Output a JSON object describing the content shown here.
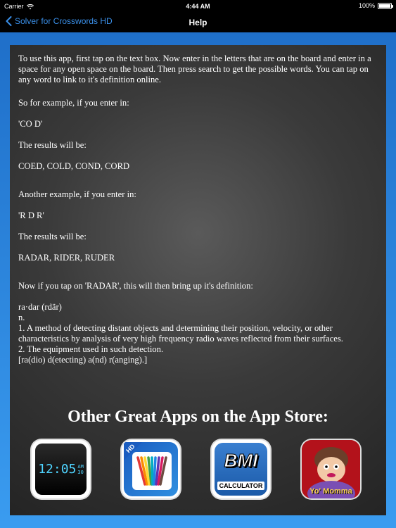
{
  "status_bar": {
    "carrier": "Carrier",
    "time": "4:44 AM",
    "battery": "100%",
    "battery_level": 1.0
  },
  "nav": {
    "back_label": "Solver for Crosswords HD",
    "title": "Help"
  },
  "help": {
    "intro": "To use this app, first tap on the text box. Now enter in the letters that are on the board and enter in a space for any open space on the board. Then press search to get the possible words. You can tap on any word to link to it's definition online.",
    "example1_lead": "So for example, if you enter in:",
    "example1_input": "'CO D'",
    "example1_results_lead": "The results will be:",
    "example1_results": "COED, COLD, COND, CORD",
    "example2_lead": "Another example, if you enter in:",
    "example2_input": "'R D R'",
    "example2_results_lead": "The results will be:",
    "example2_results": "RADAR, RIDER, RUDER",
    "tap_line": "Now if you tap on 'RADAR', this will then bring up it's definition:",
    "def_word": "ra·dar  (rdär)",
    "def_pos": "n.",
    "def_1": "1. A method of detecting distant objects and determining their position, velocity, or other characteristics by analysis of very high frequency radio waves reflected from their surfaces.",
    "def_2": "2. The equipment used in such detection.",
    "def_etym": "[ra(dio) d(etecting) a(nd) r(anging).]"
  },
  "promo": {
    "heading": "Other Great Apps on the App Store:",
    "apps": [
      {
        "icon": "alarm-clock-app-icon",
        "clock_text": "12:05",
        "am": "AM",
        "sec": "30"
      },
      {
        "icon": "colored-pencils-app-icon",
        "badge": "HD"
      },
      {
        "icon": "bmi-calculator-app-icon",
        "title": "BMI",
        "subtitle": "CALCULATOR"
      },
      {
        "icon": "yo-momma-app-icon",
        "caption": "Yo' Momma"
      }
    ]
  }
}
